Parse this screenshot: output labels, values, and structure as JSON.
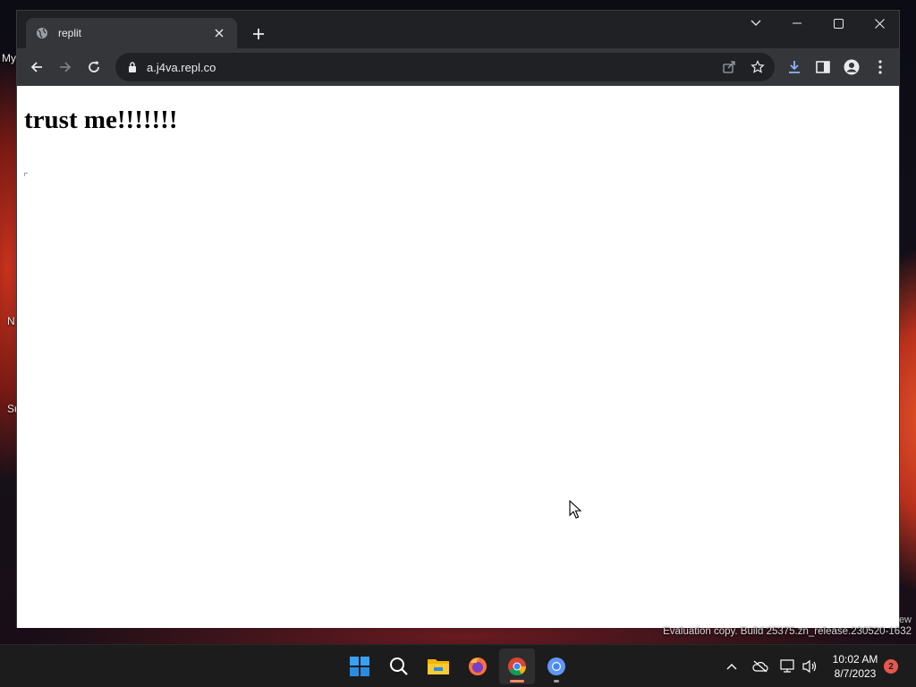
{
  "browser": {
    "tab": {
      "title": "replit",
      "icon": "globe-icon"
    },
    "address_bar": {
      "url": "a.j4va.repl.co"
    }
  },
  "page": {
    "heading": "trust me!!!!!!!"
  },
  "desktop": {
    "fragments": [
      "My",
      "N",
      "Su"
    ],
    "watermark_partial": "ew",
    "watermark": "Evaluation copy. Build 25375.zn_release.230520-1632"
  },
  "taskbar": {
    "apps": [
      "start-icon",
      "search-icon",
      "file-explorer-icon",
      "firefox-icon",
      "chrome-icon",
      "chrome-alt-icon"
    ],
    "clock": {
      "time": "10:02 AM",
      "date": "8/7/2023"
    },
    "notification_count": "2"
  },
  "colors": {
    "chrome_dark": "#202124",
    "toolbar": "#35363a",
    "download_accent": "#8ab4f8",
    "notification_badge": "#e8574d"
  }
}
